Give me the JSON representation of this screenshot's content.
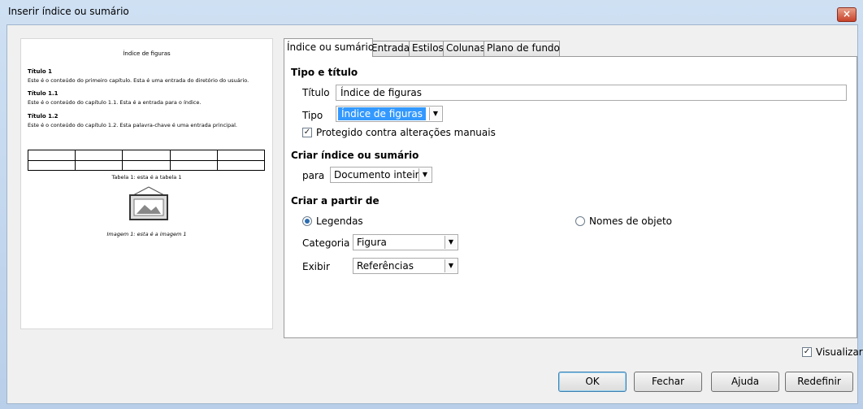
{
  "window": {
    "title": "Inserir índice ou sumário",
    "close_icon": "×"
  },
  "preview": {
    "title": "Índice de figuras",
    "h1": "Título 1",
    "t1": "Este é o conteúdo do primeiro capítulo. Esta é uma entrada do diretório do usuário.",
    "h11": "Título 1.1",
    "t11": "Este é o conteúdo do capítulo 1.1. Esta é a entrada para o índice.",
    "h12": "Título 1.2",
    "t12": "Este é o conteúdo do capítulo 1.2. Esta palavra-chave é uma entrada principal.",
    "table_caption": "Tabela 1: esta é a tabela 1",
    "image_caption": "Imagem 1: esta é a imagem 1"
  },
  "tabs": [
    "Índice ou sumário",
    "Entradas",
    "Estilos",
    "Colunas",
    "Plano de fundo"
  ],
  "type_section": {
    "heading": "Tipo e título",
    "title_label": "Título",
    "title_value": "Índice de figuras",
    "type_label": "Tipo",
    "type_value": "Índice de figuras",
    "protected_label": "Protegido contra alterações manuais",
    "protected_checked": true
  },
  "create_section": {
    "heading": "Criar índice ou sumário",
    "for_label": "para",
    "for_value": "Documento inteiro"
  },
  "from_section": {
    "heading": "Criar a partir de",
    "captions_label": "Legendas",
    "object_names_label": "Nomes de objeto",
    "selected": "captions",
    "category_label": "Categoria",
    "category_value": "Figura",
    "display_label": "Exibir",
    "display_value": "Referências"
  },
  "preview_toggle": {
    "label": "Visualizar",
    "checked": true
  },
  "buttons": {
    "ok": "OK",
    "close": "Fechar",
    "help": "Ajuda",
    "reset": "Redefinir"
  }
}
